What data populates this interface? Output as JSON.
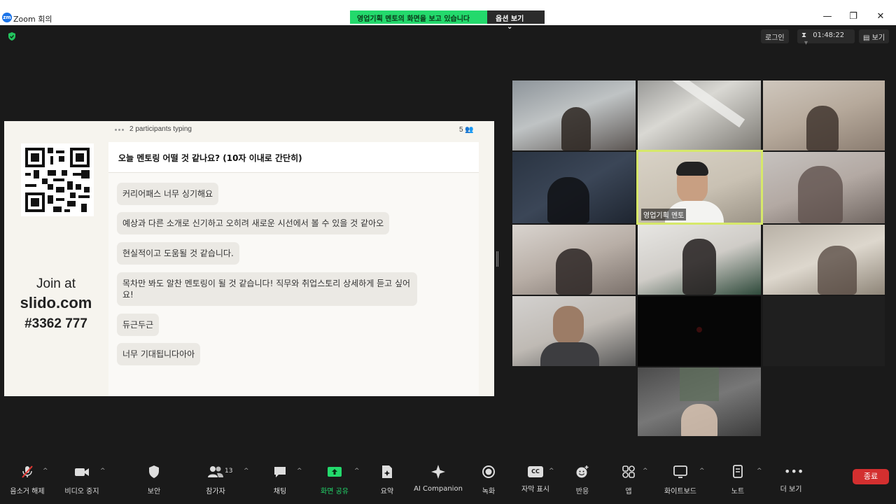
{
  "window": {
    "title": "Zoom 회의",
    "logo": "zm"
  },
  "share_banner": {
    "text": "영업기획 멘토의 화면을 보고 있습니다",
    "options": "옵션 보기"
  },
  "top_right": {
    "login": "로그인",
    "timer": "01:48:22",
    "view": "보기"
  },
  "slide": {
    "typing": "2 participants typing",
    "participant_count": "5",
    "join": {
      "line1": "Join at",
      "line2": "slido.com",
      "line3": "#3362 777"
    },
    "question": "오늘 멘토링 어떨 것 같나요? (10자 이내로 간단히)",
    "responses": [
      "커리어패스 너무 싱기해요",
      "예상과 다른 소개로 신기하고 오히려 새로운 시선에서 볼 수 있을 것 같아오",
      "현실적이고 도움될 것 같습니다.",
      "목차만 봐도 알찬 멘토링이 될 것 같습니다! 직무와 취업스토리 상세하게 듣고 싶어요!",
      "듀근두근",
      "너무 기대됩니다아아"
    ]
  },
  "gallery": {
    "active_speaker": "영업기획 멘토"
  },
  "toolbar": {
    "items": [
      {
        "label": "음소거 해제"
      },
      {
        "label": "비디오 중지"
      },
      {
        "label": "보안"
      },
      {
        "label": "참가자",
        "badge": "13"
      },
      {
        "label": "채팅"
      },
      {
        "label": "화면 공유"
      },
      {
        "label": "요약"
      },
      {
        "label": "AI Companion"
      },
      {
        "label": "녹화"
      },
      {
        "label": "자막 표시",
        "icon_text": "CC"
      },
      {
        "label": "반응"
      },
      {
        "label": "앱"
      },
      {
        "label": "화이트보드"
      },
      {
        "label": "노트"
      },
      {
        "label": "더 보기"
      }
    ],
    "end_label": "종료"
  },
  "colors": {
    "share_green": "#23d96c",
    "end_red": "#d32f2f",
    "speaker_border": "#d6e86a"
  }
}
